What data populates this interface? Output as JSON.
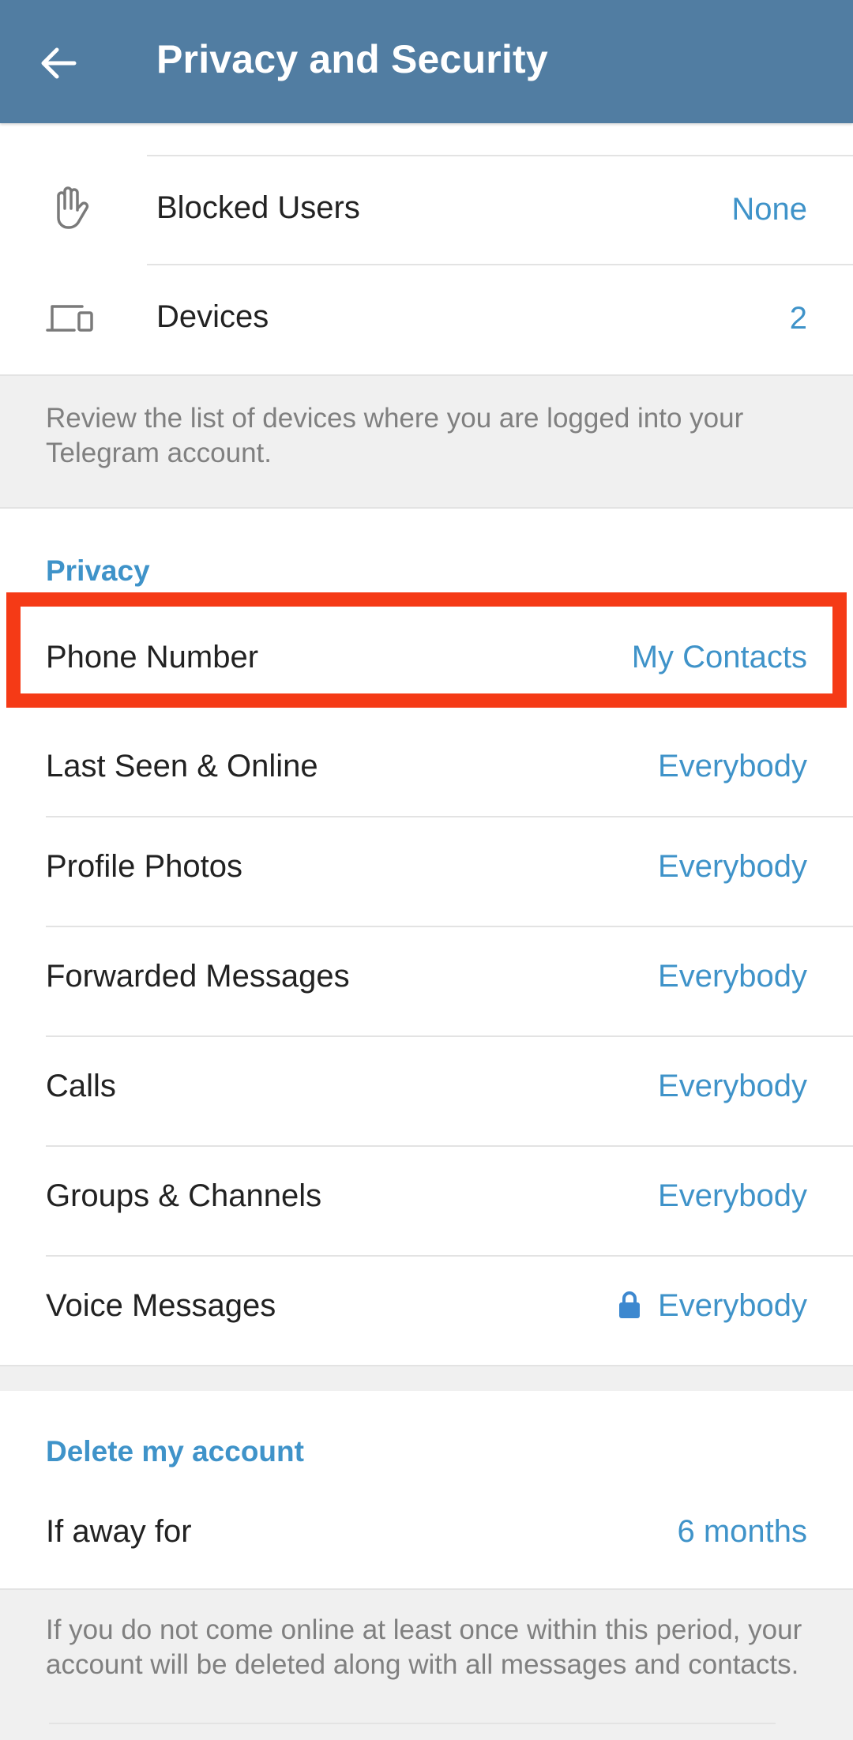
{
  "app_bar": {
    "title": "Privacy and Security",
    "back_icon": "arrow-left-icon",
    "background_color": "#517da2"
  },
  "security": {
    "items": [
      {
        "icon": "raised-hand-icon",
        "label": "Blocked Users",
        "value": "None"
      },
      {
        "icon": "devices-icon",
        "label": "Devices",
        "value": "2"
      }
    ],
    "hint": "Review the list of devices where you are logged into your Telegram account."
  },
  "privacy": {
    "header": "Privacy",
    "items": [
      {
        "label": "Phone Number",
        "value": "My Contacts",
        "highlighted": true
      },
      {
        "label": "Last Seen & Online",
        "value": "Everybody"
      },
      {
        "label": "Profile Photos",
        "value": "Everybody"
      },
      {
        "label": "Forwarded Messages",
        "value": "Everybody"
      },
      {
        "label": "Calls",
        "value": "Everybody"
      },
      {
        "label": "Groups & Channels",
        "value": "Everybody"
      },
      {
        "label": "Voice Messages",
        "value": "Everybody",
        "locked": true,
        "value_icon": "lock-icon"
      }
    ]
  },
  "delete_account": {
    "header": "Delete my account",
    "item": {
      "label": "If away for",
      "value": "6 months"
    },
    "hint": "If you do not come online at least once within this period, your account will be deleted along with all messages and contacts."
  },
  "colors": {
    "accent": "#3f93c9",
    "highlight_border": "#f53a16",
    "text_primary": "#222222",
    "text_secondary": "#808080",
    "background": "#f0f0f0"
  }
}
